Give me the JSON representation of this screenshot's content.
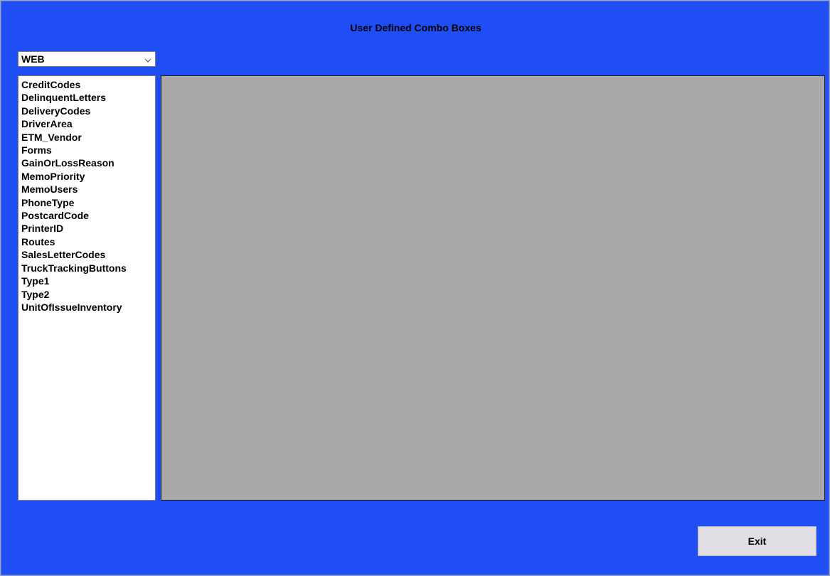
{
  "window": {
    "title": "User Defined Combo Boxes",
    "background_color": "#1f4ef5"
  },
  "combo": {
    "selected_value": "WEB",
    "arrow_icon": "chevron-down-icon"
  },
  "list": {
    "items": [
      "CreditCodes",
      "DelinquentLetters",
      "DeliveryCodes",
      "DriverArea",
      "ETM_Vendor",
      "Forms",
      "GainOrLossReason",
      "MemoPriority",
      "MemoUsers",
      "PhoneType",
      "PostcardCode",
      "PrinterID",
      "Routes",
      "SalesLetterCodes",
      "TruckTrackingButtons",
      "Type1",
      "Type2",
      "UnitOfIssueInventory"
    ]
  },
  "grid": {
    "background_color": "#a9a9a9"
  },
  "actions": {
    "exit_label": "Exit"
  }
}
